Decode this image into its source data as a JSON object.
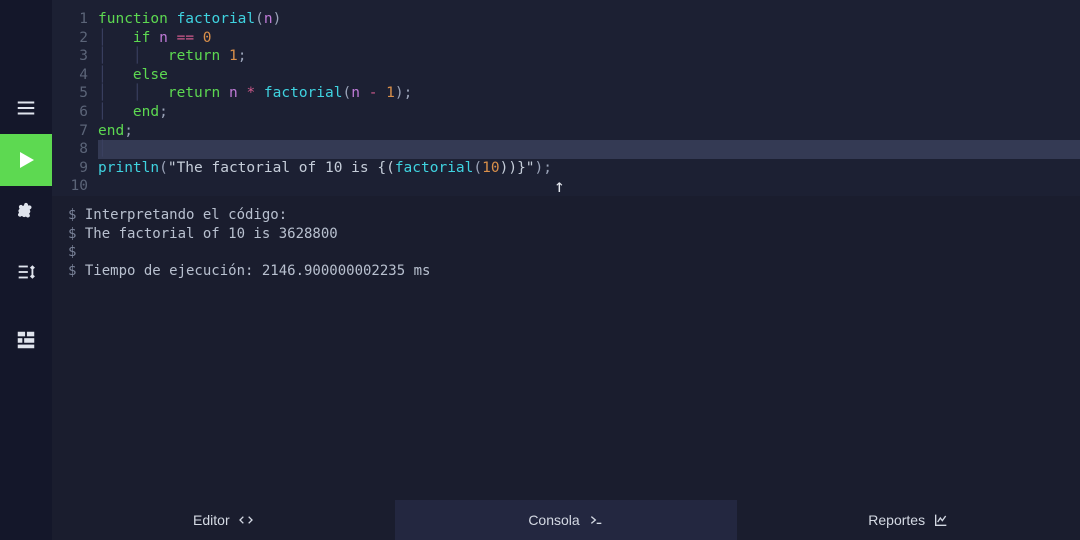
{
  "sidebar": {
    "menu": "menu",
    "run": "run",
    "settings": "settings",
    "steps": "steps",
    "grid": "grid"
  },
  "editor": {
    "lines": [
      {
        "n": "1"
      },
      {
        "n": "2"
      },
      {
        "n": "3"
      },
      {
        "n": "4"
      },
      {
        "n": "5"
      },
      {
        "n": "6"
      },
      {
        "n": "7"
      },
      {
        "n": "8"
      },
      {
        "n": "9"
      },
      {
        "n": "10"
      }
    ],
    "tokens": {
      "function": "function",
      "factorial": "factorial",
      "n": "n",
      "if": "if",
      "eq": "==",
      "zero": "0",
      "return": "return",
      "one": "1",
      "else": "else",
      "star": "*",
      "minus": "-",
      "end": "end",
      "println": "println",
      "str_open": "\"The factorial of 10 is {(",
      "str_close": "))}\"",
      "ten": "10",
      "semi": ";",
      "lp": "(",
      "rp": ")"
    }
  },
  "console": {
    "l1": "Interpretando el código:",
    "l2": "The factorial of 10 is 3628800",
    "l3": "",
    "l4": "Tiempo de ejecución: 2146.900000002235 ms",
    "prompt": "$ "
  },
  "tabs": {
    "editor": "Editor",
    "consola": "Consola",
    "reportes": "Reportes"
  }
}
